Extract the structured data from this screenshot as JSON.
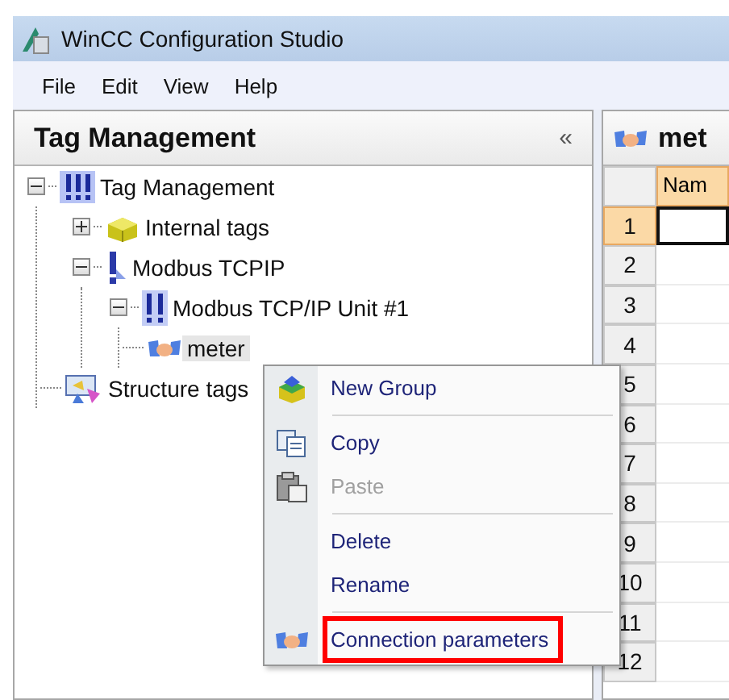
{
  "window": {
    "title": "WinCC Configuration Studio"
  },
  "menu_bar": [
    "File",
    "Edit",
    "View",
    "Help"
  ],
  "navigation": {
    "title": "Tag Management",
    "collapse": "«",
    "tree": [
      {
        "label": "Tag Management",
        "kind": "root",
        "expanded": true,
        "children": [
          {
            "label": "Internal tags",
            "kind": "folder",
            "expanded": false
          },
          {
            "label": "Modbus TCPIP",
            "kind": "driver",
            "expanded": true,
            "children": [
              {
                "label": "Modbus TCP/IP Unit #1",
                "kind": "unit",
                "expanded": true,
                "children": [
                  {
                    "label": "meter",
                    "kind": "connection",
                    "selected": true
                  }
                ]
              }
            ]
          },
          {
            "label": "Structure tags",
            "kind": "structure"
          }
        ]
      }
    ]
  },
  "editor": {
    "title": "met",
    "columns": [
      {
        "label": "Nam",
        "selected": true
      }
    ],
    "rows": [
      {
        "number": "1",
        "selected": true
      },
      {
        "number": "2",
        "selected": false
      },
      {
        "number": "3",
        "selected": false
      },
      {
        "number": "4",
        "selected": false
      },
      {
        "number": "5",
        "selected": false
      },
      {
        "number": "6",
        "selected": false
      },
      {
        "number": "7",
        "selected": false
      },
      {
        "number": "8",
        "selected": false
      },
      {
        "number": "9",
        "selected": false
      },
      {
        "number": "10",
        "selected": false
      },
      {
        "number": "11",
        "selected": false
      },
      {
        "number": "12",
        "selected": false
      }
    ]
  },
  "context_menu": [
    {
      "kind": "group",
      "label": "New Group",
      "disabled": false,
      "highlighted": false
    },
    {
      "kind": "separator"
    },
    {
      "kind": "copy",
      "label": "Copy",
      "disabled": false,
      "highlighted": false
    },
    {
      "kind": "paste",
      "label": "Paste",
      "disabled": true,
      "highlighted": false
    },
    {
      "kind": "separator"
    },
    {
      "kind": "plain",
      "label": "Delete",
      "disabled": false,
      "highlighted": false
    },
    {
      "kind": "plain",
      "label": "Rename",
      "disabled": false,
      "highlighted": false
    },
    {
      "kind": "separator"
    },
    {
      "kind": "connection",
      "label": "Connection parameters",
      "disabled": false,
      "highlighted": true
    }
  ]
}
